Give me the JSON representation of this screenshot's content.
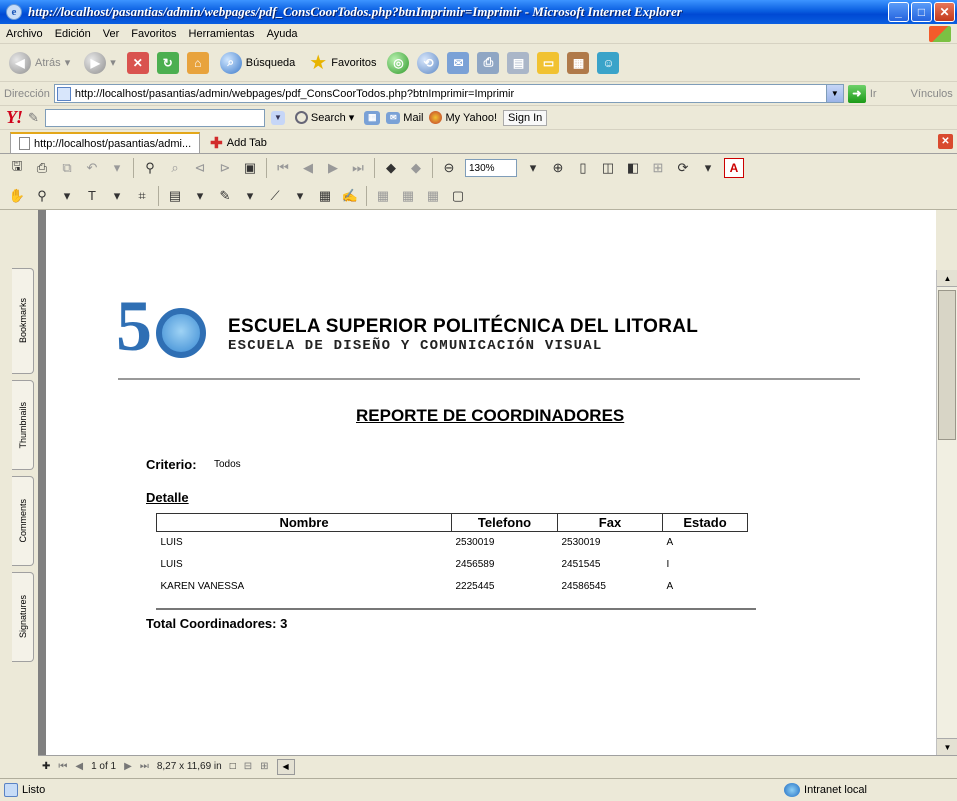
{
  "window": {
    "title": "http://localhost/pasantias/admin/webpages/pdf_ConsCoorTodos.php?btnImprimir=Imprimir - Microsoft Internet Explorer"
  },
  "menu": [
    "Archivo",
    "Edición",
    "Ver",
    "Favoritos",
    "Herramientas",
    "Ayuda"
  ],
  "toolbar": {
    "back_label": "Atrás",
    "search_label": "Búsqueda",
    "favorites_label": "Favoritos"
  },
  "address": {
    "label": "Dirección",
    "url": "http://localhost/pasantias/admin/webpages/pdf_ConsCoorTodos.php?btnImprimir=Imprimir",
    "go_label": "Ir",
    "links_label": "Vínculos"
  },
  "yahoo": {
    "logo": "Y!",
    "search_label": "Search",
    "mail_label": "Mail",
    "myyahoo_label": "My Yahoo!",
    "signin_label": "Sign In"
  },
  "tabs": {
    "active_label": "http://localhost/pasantias/admi...",
    "add_label": "Add Tab"
  },
  "acrobat": {
    "zoom": "130%",
    "side_tabs": [
      "Bookmarks",
      "Thumbnails",
      "Comments",
      "Signatures"
    ],
    "page_indicator": "1 of 1",
    "page_size": "8,27 x 11,69 in"
  },
  "document": {
    "institution_line1": "ESCUELA SUPERIOR POLITÉCNICA DEL LITORAL",
    "institution_line2": "ESCUELA DE DISEÑO Y COMUNICACIÓN VISUAL",
    "report_title": "REPORTE DE COORDINADORES",
    "criteria_label": "Criterio:",
    "criteria_value": "Todos",
    "detail_label": "Detalle",
    "columns": [
      "Nombre",
      "Telefono",
      "Fax",
      "Estado"
    ],
    "rows": [
      [
        "LUIS",
        "2530019",
        "2530019",
        "A"
      ],
      [
        "LUIS",
        "2456589",
        "2451545",
        "I"
      ],
      [
        "KAREN VANESSA",
        "2225445",
        "24586545",
        "A"
      ]
    ],
    "total_text": "Total Coordinadores: 3"
  },
  "status": {
    "text": "Listo",
    "zone": "Intranet local"
  }
}
